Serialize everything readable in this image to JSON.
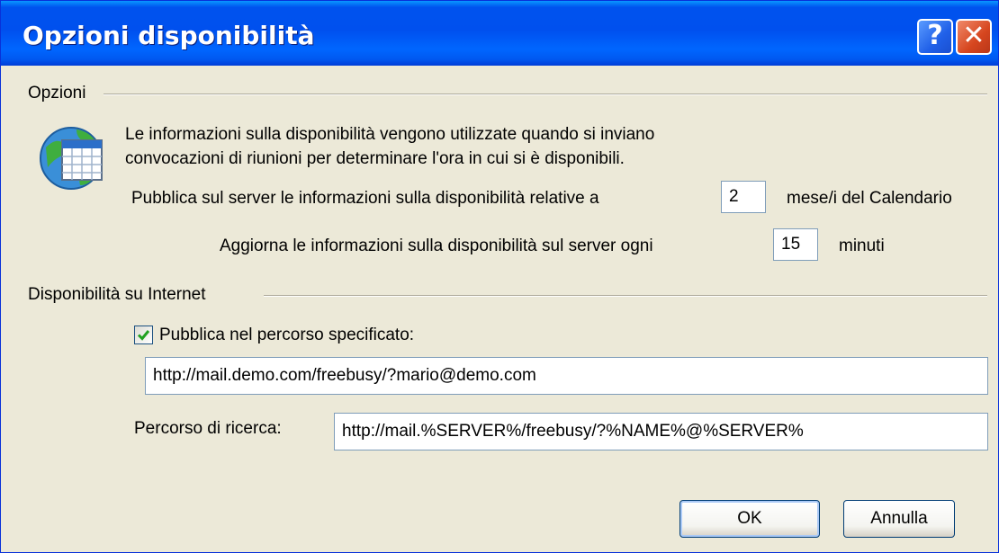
{
  "window": {
    "title": "Opzioni disponibilità",
    "help_symbol": "?",
    "close_symbol": "✕"
  },
  "options": {
    "group_label": "Opzioni",
    "icon": "calendar-globe-icon",
    "description_line1": "Le informazioni sulla disponibilità vengono utilizzate quando si inviano",
    "description_line2": "convocazioni di riunioni per determinare l'ora in cui si è disponibili.",
    "publish_label": "Pubblica sul server le informazioni sulla disponibilità relative a",
    "publish_months": "2",
    "publish_unit": "mese/i del Calendario",
    "update_label": "Aggiorna le informazioni sulla disponibilità sul server ogni",
    "update_minutes": "15",
    "update_unit": "minuti"
  },
  "internet": {
    "group_label": "Disponibilità su Internet",
    "publish_checkbox_label": "Pubblica nel percorso specificato:",
    "publish_checked": true,
    "publish_url": "http://mail.demo.com/freebusy/?mario@demo.com",
    "search_label": "Percorso di ricerca:",
    "search_url": "http://mail.%SERVER%/freebusy/?%NAME%@%SERVER%"
  },
  "buttons": {
    "ok": "OK",
    "cancel": "Annulla"
  },
  "colors": {
    "titlebar": "#0053ee",
    "dialog_bg": "#ece9d8",
    "check": "#21a121"
  }
}
